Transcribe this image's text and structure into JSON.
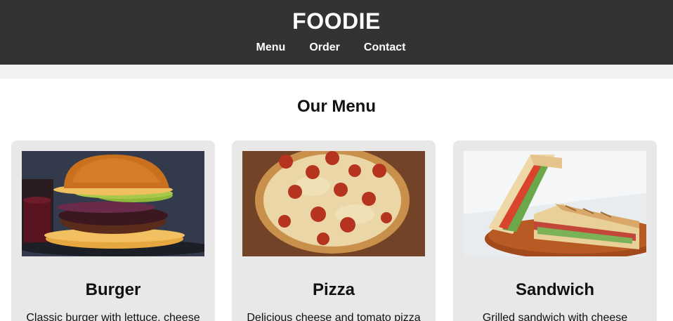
{
  "header": {
    "brand": "FOODIE",
    "nav": [
      {
        "label": "Menu"
      },
      {
        "label": "Order"
      },
      {
        "label": "Contact"
      }
    ]
  },
  "menu": {
    "title": "Our Menu",
    "items": [
      {
        "name": "Burger",
        "description": "Classic burger with lettuce, cheese",
        "image_icon": "burger-photo"
      },
      {
        "name": "Pizza",
        "description": "Delicious cheese and tomato pizza",
        "image_icon": "pizza-photo"
      },
      {
        "name": "Sandwich",
        "description": "Grilled sandwich with cheese",
        "image_icon": "sandwich-photo"
      }
    ]
  },
  "colors": {
    "header_bg": "#333333",
    "band_bg": "#f2f2f2",
    "card_bg": "#e8e8e8"
  }
}
